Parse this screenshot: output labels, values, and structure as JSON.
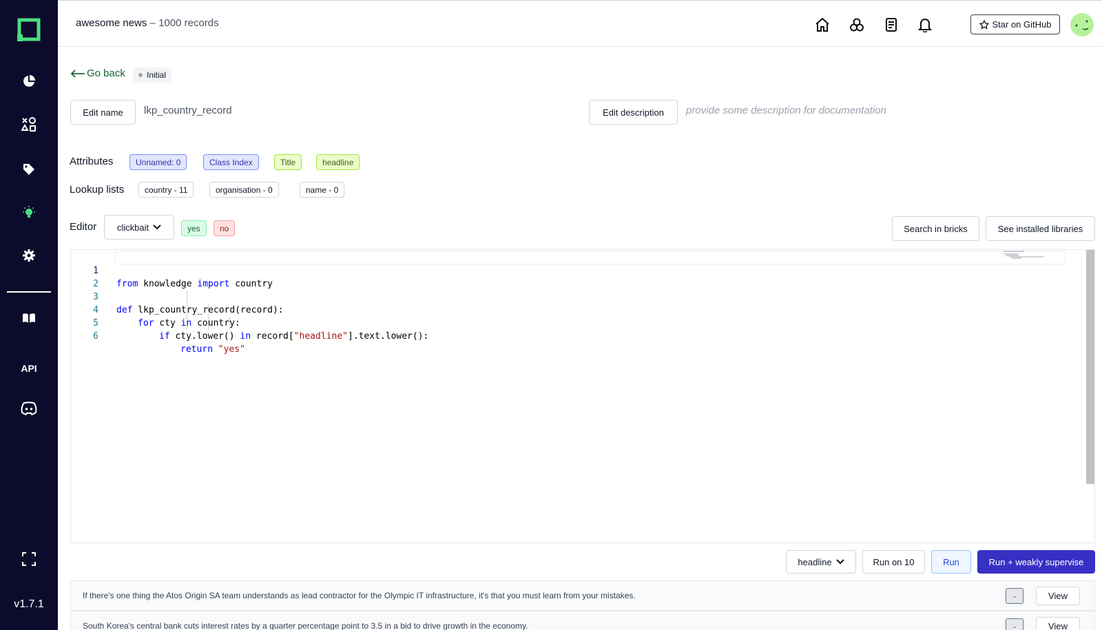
{
  "app": {
    "version": "v1.7.1",
    "sidebar_items": [
      {
        "icon": "chart-pie-icon"
      },
      {
        "icon": "shapes-icon"
      },
      {
        "icon": "tag-icon"
      },
      {
        "icon": "bulb-icon"
      },
      {
        "icon": "gear-icon"
      },
      {
        "icon": "book-icon"
      },
      {
        "label": "API"
      },
      {
        "icon": "discord-icon"
      },
      {
        "icon": "fullscreen-icon"
      }
    ]
  },
  "header": {
    "project_name": "awesome news",
    "record_count": " – 1000 records",
    "github_label": "Star on GitHub"
  },
  "page": {
    "go_back": "Go back",
    "status": "Initial",
    "edit_name_label": "Edit name",
    "name_value": "lkp_country_record",
    "edit_description_label": "Edit description",
    "description_placeholder": "provide some description for documentation",
    "attributes_label": "Attributes",
    "attributes": [
      "Unnamed: 0",
      "Class Index",
      "Title",
      "headline"
    ],
    "lookup_label": "Lookup lists",
    "lookup_lists": [
      "country - 11",
      "organisation - 0",
      "name - 0"
    ],
    "editor_label": "Editor",
    "label_task": "clickbait",
    "labels": [
      "yes",
      "no"
    ],
    "search_bricks": "Search in bricks",
    "installed_libraries": "See installed libraries"
  },
  "editor": {
    "line_numbers": [
      "1",
      "2",
      "3",
      "4",
      "5",
      "6"
    ],
    "line1": {
      "kw1": "from",
      "t1": " knowledge ",
      "kw2": "import",
      "t2": " country"
    },
    "line3": {
      "kw1": "def",
      "t1": " lkp_country_record(record):"
    },
    "line4": {
      "kw1": "for",
      "t1": " cty ",
      "kw2": "in",
      "t2": " country:"
    },
    "line5": {
      "kw1": "if",
      "t1": " cty.lower() ",
      "kw2": "in",
      "t2": " record[",
      "s1": "\"headline\"",
      "t3": "].text.lower():"
    },
    "line6": {
      "kw1": "return",
      "t1": " ",
      "s1": "\"yes\""
    }
  },
  "run_bar": {
    "attribute": "headline",
    "run_on_10": "Run on 10",
    "run": "Run",
    "run_supervise": "Run + weakly supervise"
  },
  "records": [
    {
      "text": "If there's one thing the Atos Origin SA team understands as lead contractor for the Olympic IT infrastructure, it's that you must learn from your mistakes.",
      "result": "-",
      "view": "View"
    },
    {
      "text": "South Korea's central bank cuts interest rates by a quarter percentage point to 3.5 in a bid to drive growth in the economy.",
      "result": "-",
      "view": "View"
    }
  ],
  "colors": {
    "sidebar": "#0d0b2b",
    "brand_green": "#4ade80",
    "primary_button": "#3730c4"
  }
}
